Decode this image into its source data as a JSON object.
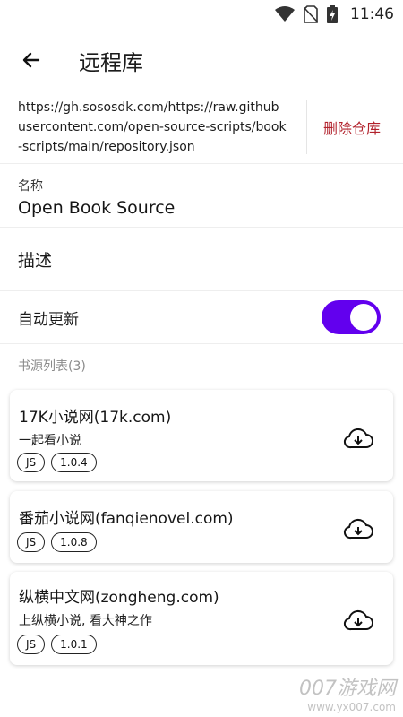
{
  "status": {
    "time": "11:46"
  },
  "header": {
    "title": "远程库"
  },
  "repository": {
    "url": "https://gh.sososdk.com/https://raw.githubusercontent.com/open-source-scripts/book-scripts/main/repository.json",
    "delete_label": "删除仓库",
    "name_label": "名称",
    "name_value": "Open Book Source",
    "description_label": "描述",
    "auto_update_label": "自动更新",
    "auto_update_on": true
  },
  "sources": {
    "section_label": "书源列表(3)",
    "items": [
      {
        "title": "17K小说网(17k.com)",
        "subtitle": "一起看小说",
        "tags": [
          "JS",
          "1.0.4"
        ]
      },
      {
        "title": "番茄小说网(fanqienovel.com)",
        "subtitle": "",
        "tags": [
          "JS",
          "1.0.8"
        ]
      },
      {
        "title": "纵横中文网(zongheng.com)",
        "subtitle": "上纵横小说, 看大神之作",
        "tags": [
          "JS",
          "1.0.1"
        ]
      }
    ]
  },
  "watermark": {
    "line1": "007游戏网",
    "line2": "www.yx007.com"
  },
  "colors": {
    "accent": "#6200ee",
    "danger": "#b2222c"
  }
}
